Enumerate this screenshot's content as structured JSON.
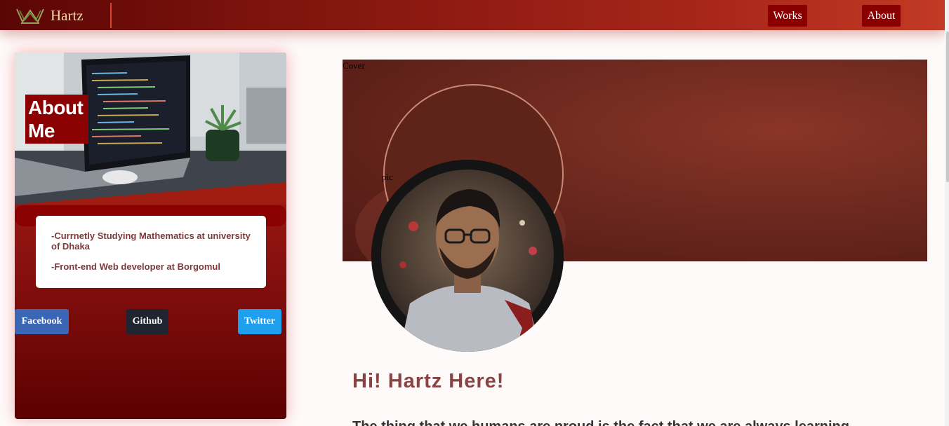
{
  "navbar": {
    "brand": "Hartz",
    "brand_icon": "crown-icon",
    "links": [
      "Works",
      "About"
    ]
  },
  "profile_card": {
    "heading": "About Me",
    "details": [
      "-Currnetly Studying Mathematics at university of Dhaka",
      "-Front-end Web developer at Borgomul"
    ],
    "social": [
      "Facebook",
      "Github",
      "Twitter"
    ]
  },
  "cover": {
    "alt_label": "Cover",
    "pic_alt_label": "pic"
  },
  "intro": {
    "greeting": "Hi! Hartz Here!",
    "tagline": "The thing that we humans are proud is the fact that we are always learning"
  },
  "colors": {
    "nav_start": "#5a0505",
    "nav_end": "#c23a24",
    "accent_dark_red": "#8b0000",
    "facebook": "#3b66b6",
    "github": "#1f2530",
    "twitter": "#1ea0ee",
    "headline": "#8a4343"
  }
}
